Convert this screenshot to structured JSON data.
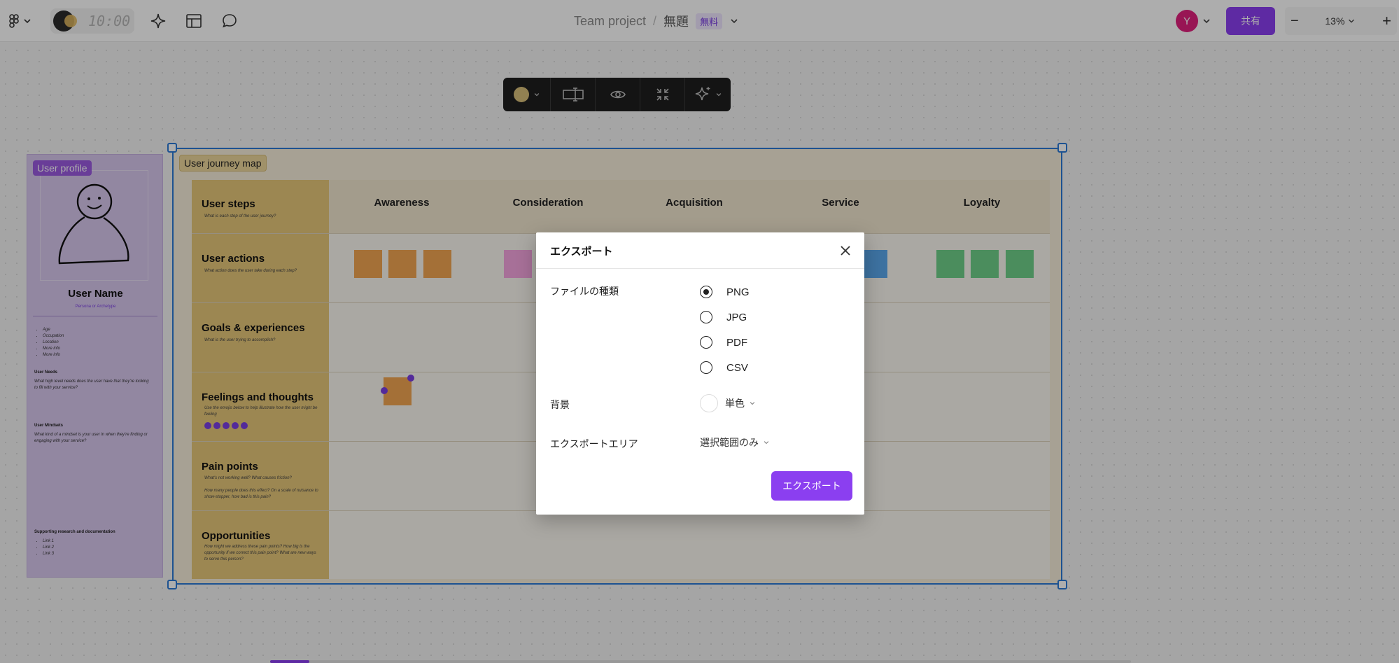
{
  "topbar": {
    "timer_text": "10:00",
    "team_name": "Team project",
    "breadcrumb_sep": "/",
    "file_name": "無題",
    "plan_badge": "無料",
    "user_initial": "Y",
    "share_label": "共有",
    "zoom_minus": "−",
    "zoom_level": "13%",
    "zoom_plus": "+",
    "brand_color": "#8b3ff0"
  },
  "canvas": {
    "user_profile": {
      "label": "User profile",
      "name": "User Name",
      "persona": "Persona or Archetype",
      "bullets": [
        "Age",
        "Occupation",
        "Location",
        "More info",
        "More info"
      ],
      "needs_title": "User Needs",
      "needs_text": "What high level needs does the user have that they're looking to fill with your service?",
      "mindsets_title": "User Mindsets",
      "mindsets_text": "What kind of a mindset is your user in when they're finding or engaging with your service?",
      "research_title": "Supporting research and documentation",
      "links": [
        "Link 1",
        "Link 2",
        "Link 3"
      ]
    },
    "journey_map": {
      "label": "User journey map",
      "columns": [
        "Awareness",
        "Consideration",
        "Acquisition",
        "Service",
        "Loyalty"
      ],
      "rows": [
        {
          "title": "User steps",
          "sub": "What is each step of the user journey?"
        },
        {
          "title": "User actions",
          "sub": "What action does the user take during each step?"
        },
        {
          "title": "Goals & experiences",
          "sub": "What is the user trying to accomplish?"
        },
        {
          "title": "Feelings and thoughts",
          "sub": "Use the emojis below to help illustrate how the user might be feeling"
        },
        {
          "title": "Pain points",
          "sub": "What's not working well? What causes friction?"
        },
        {
          "title": "Opportunities",
          "sub": "How might we address these pain points? How big is the opportunity if we correct this pain point? What are new ways to serve this person?"
        }
      ],
      "pain_points_extra": "How many people does this effect? On a scale of nuisance to show-stopper, how bad is this pain?"
    }
  },
  "export_dialog": {
    "title": "エクスポート",
    "file_type_label": "ファイルの種類",
    "file_types": [
      "PNG",
      "JPG",
      "PDF",
      "CSV"
    ],
    "selected_file_type": "PNG",
    "background_label": "背景",
    "background_value": "単色",
    "area_label": "エクスポートエリア",
    "area_value": "選択範囲のみ",
    "export_button": "エクスポート"
  }
}
